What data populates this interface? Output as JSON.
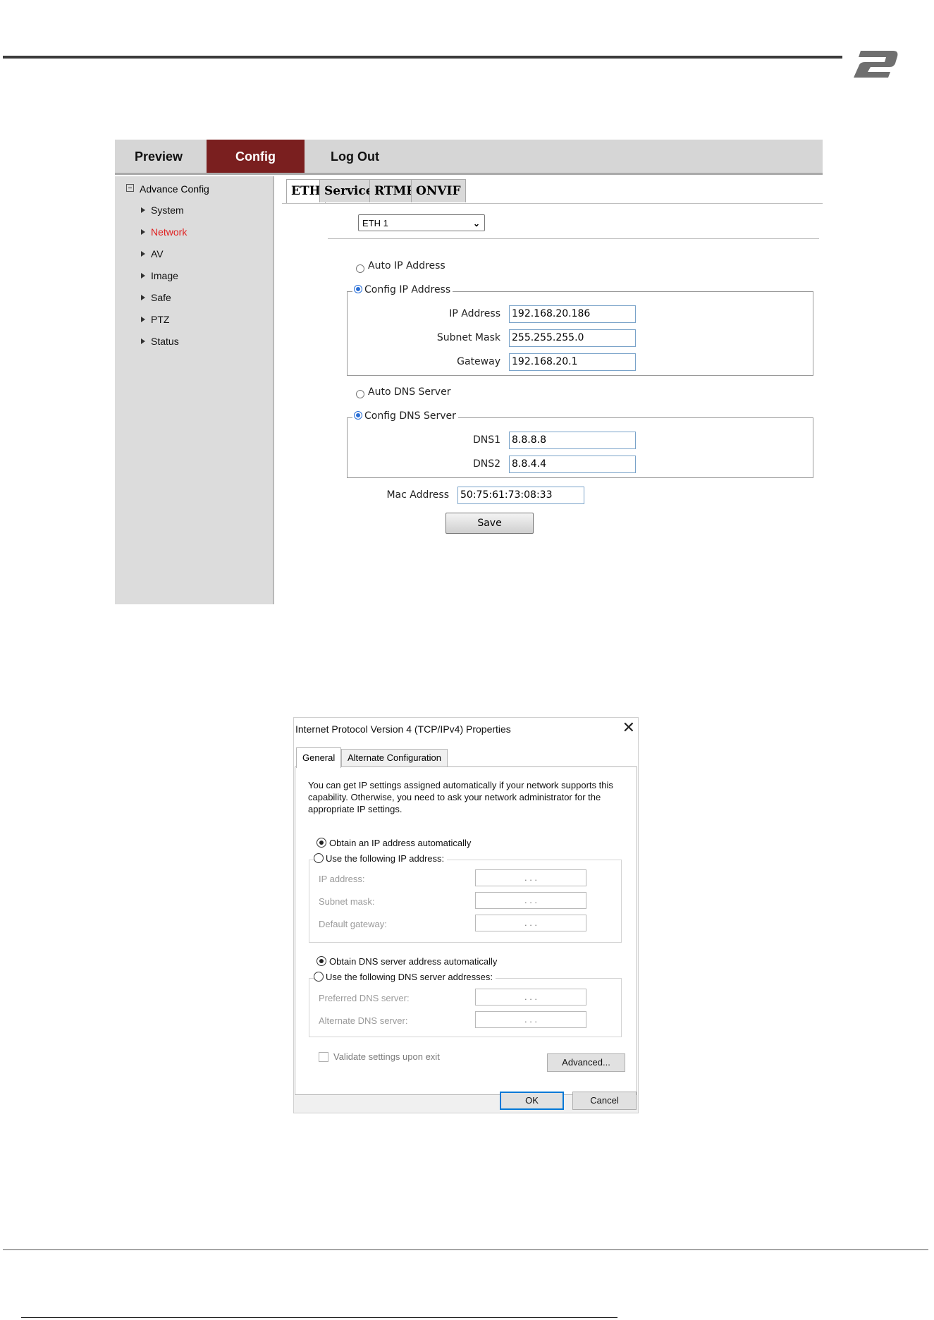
{
  "camera_ui": {
    "nav": {
      "preview": "Preview",
      "config": "Config",
      "logout": "Log Out"
    },
    "sidebar": {
      "root": "Advance Config",
      "items": [
        "System",
        "Network",
        "AV",
        "Image",
        "Safe",
        "PTZ",
        "Status"
      ],
      "active": "Network"
    },
    "tabs": [
      "ETH",
      "Service",
      "RTMP",
      "ONVIF"
    ],
    "interface_select": "ETH 1",
    "ip": {
      "auto_label": "Auto IP Address",
      "config_label": "Config IP Address",
      "fields": [
        {
          "label": "IP Address",
          "value": "192.168.20.186"
        },
        {
          "label": "Subnet Mask",
          "value": "255.255.255.0"
        },
        {
          "label": "Gateway",
          "value": "192.168.20.1"
        }
      ]
    },
    "dns": {
      "auto_label": "Auto DNS Server",
      "config_label": "Config DNS Server",
      "fields": [
        {
          "label": "DNS1",
          "value": "8.8.8.8"
        },
        {
          "label": "DNS2",
          "value": "8.8.4.4"
        }
      ]
    },
    "mac": {
      "label": "Mac Address",
      "value": "50:75:61:73:08:33"
    },
    "save_label": "Save"
  },
  "dialog": {
    "title": "Internet Protocol Version 4 (TCP/IPv4) Properties",
    "tabs": [
      "General",
      "Alternate Configuration"
    ],
    "intro": "You can get IP settings assigned automatically if your network supports this capability. Otherwise, you need to ask your network administrator for the appropriate IP settings.",
    "obtain_ip": "Obtain an IP address automatically",
    "use_ip": "Use the following IP address:",
    "ip_fields": [
      "IP address:",
      "Subnet mask:",
      "Default gateway:"
    ],
    "obtain_dns": "Obtain DNS server address automatically",
    "use_dns": "Use the following DNS server addresses:",
    "dns_fields": [
      "Preferred DNS server:",
      "Alternate DNS server:"
    ],
    "ip_placeholder": ".       .       .",
    "validate": "Validate settings upon exit",
    "advanced": "Advanced...",
    "ok": "OK",
    "cancel": "Cancel"
  }
}
